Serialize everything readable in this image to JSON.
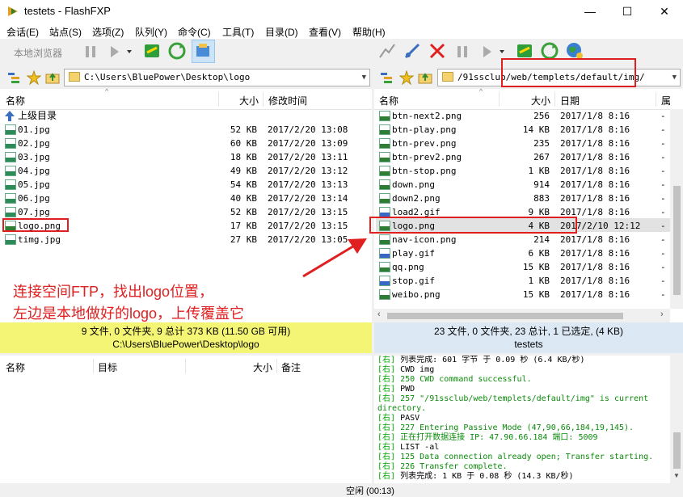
{
  "window": {
    "title": "testets - FlashFXP",
    "minimize": "—",
    "maximize": "☐",
    "close": "✕"
  },
  "menu": [
    "会话(E)",
    "站点(S)",
    "选项(Z)",
    "队列(Y)",
    "命令(C)",
    "工具(T)",
    "目录(D)",
    "查看(V)",
    "帮助(H)"
  ],
  "left_toolbar": {
    "local_browser_label": "本地浏览器"
  },
  "left_path": "C:\\Users\\BluePower\\Desktop\\logo",
  "right_path": "/91ssclub/web/templets/default/img/",
  "left_headers": {
    "name": "名称",
    "size": "大小",
    "modified": "修改时间"
  },
  "right_headers": {
    "name": "名称",
    "size": "大小",
    "date": "日期",
    "attr": "属"
  },
  "left_parent": "上级目录",
  "left_files": [
    {
      "name": "01.jpg",
      "size": "52 KB",
      "date": "2017/2/20 13:08",
      "type": "jpg"
    },
    {
      "name": "02.jpg",
      "size": "60 KB",
      "date": "2017/2/20 13:09",
      "type": "jpg"
    },
    {
      "name": "03.jpg",
      "size": "18 KB",
      "date": "2017/2/20 13:11",
      "type": "jpg"
    },
    {
      "name": "04.jpg",
      "size": "49 KB",
      "date": "2017/2/20 13:12",
      "type": "jpg"
    },
    {
      "name": "05.jpg",
      "size": "54 KB",
      "date": "2017/2/20 13:13",
      "type": "jpg"
    },
    {
      "name": "06.jpg",
      "size": "40 KB",
      "date": "2017/2/20 13:14",
      "type": "jpg"
    },
    {
      "name": "07.jpg",
      "size": "52 KB",
      "date": "2017/2/20 13:15",
      "type": "jpg"
    },
    {
      "name": "logo.png",
      "size": "17 KB",
      "date": "2017/2/20 13:15",
      "type": "png"
    },
    {
      "name": "timg.jpg",
      "size": "27 KB",
      "date": "2017/2/20 13:05",
      "type": "jpg"
    }
  ],
  "right_files": [
    {
      "name": "btn-next2.png",
      "size": "256",
      "date": "2017/1/8 8:16",
      "attr": "-",
      "type": "png"
    },
    {
      "name": "btn-play.png",
      "size": "14 KB",
      "date": "2017/1/8 8:16",
      "attr": "-",
      "type": "png"
    },
    {
      "name": "btn-prev.png",
      "size": "235",
      "date": "2017/1/8 8:16",
      "attr": "-",
      "type": "png"
    },
    {
      "name": "btn-prev2.png",
      "size": "267",
      "date": "2017/1/8 8:16",
      "attr": "-",
      "type": "png"
    },
    {
      "name": "btn-stop.png",
      "size": "1 KB",
      "date": "2017/1/8 8:16",
      "attr": "-",
      "type": "png"
    },
    {
      "name": "down.png",
      "size": "914",
      "date": "2017/1/8 8:16",
      "attr": "-",
      "type": "png"
    },
    {
      "name": "down2.png",
      "size": "883",
      "date": "2017/1/8 8:16",
      "attr": "-",
      "type": "png"
    },
    {
      "name": "load2.gif",
      "size": "9 KB",
      "date": "2017/1/8 8:16",
      "attr": "-",
      "type": "gif"
    },
    {
      "name": "logo.png",
      "size": "4 KB",
      "date": "2017/2/10 12:12",
      "attr": "-",
      "type": "png"
    },
    {
      "name": "nav-icon.png",
      "size": "214",
      "date": "2017/1/8 8:16",
      "attr": "-",
      "type": "png"
    },
    {
      "name": "play.gif",
      "size": "6 KB",
      "date": "2017/1/8 8:16",
      "attr": "-",
      "type": "gif"
    },
    {
      "name": "qq.png",
      "size": "15 KB",
      "date": "2017/1/8 8:16",
      "attr": "-",
      "type": "png"
    },
    {
      "name": "stop.gif",
      "size": "1 KB",
      "date": "2017/1/8 8:16",
      "attr": "-",
      "type": "gif"
    },
    {
      "name": "weibo.png",
      "size": "15 KB",
      "date": "2017/1/8 8:16",
      "attr": "-",
      "type": "png"
    }
  ],
  "left_status": {
    "line1": "9 文件, 0 文件夹, 9 总计 373 KB (11.50 GB 可用)",
    "line2": "C:\\Users\\BluePower\\Desktop\\logo"
  },
  "right_status": {
    "line1": "23 文件, 0 文件夹, 23 总计, 1 已选定, (4 KB)",
    "line2": "testets"
  },
  "queue_headers": {
    "name": "名称",
    "target": "目标",
    "size": "大小",
    "note": "备注"
  },
  "annotation": {
    "line1": "连接空间FTP，找出logo位置，",
    "line2": "左边是本地做好的logo，上传覆盖它"
  },
  "log_lines": [
    {
      "tag": "[右]",
      "text": " 列表完成: 601 字节 于 0.09 秒 (6.4 KB/秒)",
      "ok": false
    },
    {
      "tag": "[右]",
      "text": " CWD img",
      "ok": false
    },
    {
      "tag": "[右]",
      "text": " 250 CWD command successful.",
      "ok": true
    },
    {
      "tag": "[右]",
      "text": " PWD",
      "ok": false
    },
    {
      "tag": "[右]",
      "text": " 257 \"/91ssclub/web/templets/default/img\" is current",
      "ok": true
    },
    {
      "tag": "",
      "text": "directory.",
      "ok": true
    },
    {
      "tag": "[右]",
      "text": " PASV",
      "ok": false
    },
    {
      "tag": "[右]",
      "text": " 227 Entering Passive Mode (47,90,66,184,19,145).",
      "ok": true
    },
    {
      "tag": "[右]",
      "text": " 正在打开数据连接 IP: 47.90.66.184 端口: 5009",
      "ok": true
    },
    {
      "tag": "[右]",
      "text": " LIST -al",
      "ok": false
    },
    {
      "tag": "[右]",
      "text": " 125 Data connection already open; Transfer starting.",
      "ok": true
    },
    {
      "tag": "[右]",
      "text": " 226 Transfer complete.",
      "ok": true
    },
    {
      "tag": "[右]",
      "text": " 列表完成: 1 KB 于 0.08 秒 (14.3 KB/秒)",
      "ok": false
    }
  ],
  "bottom_status": "空闲 (00:13)"
}
